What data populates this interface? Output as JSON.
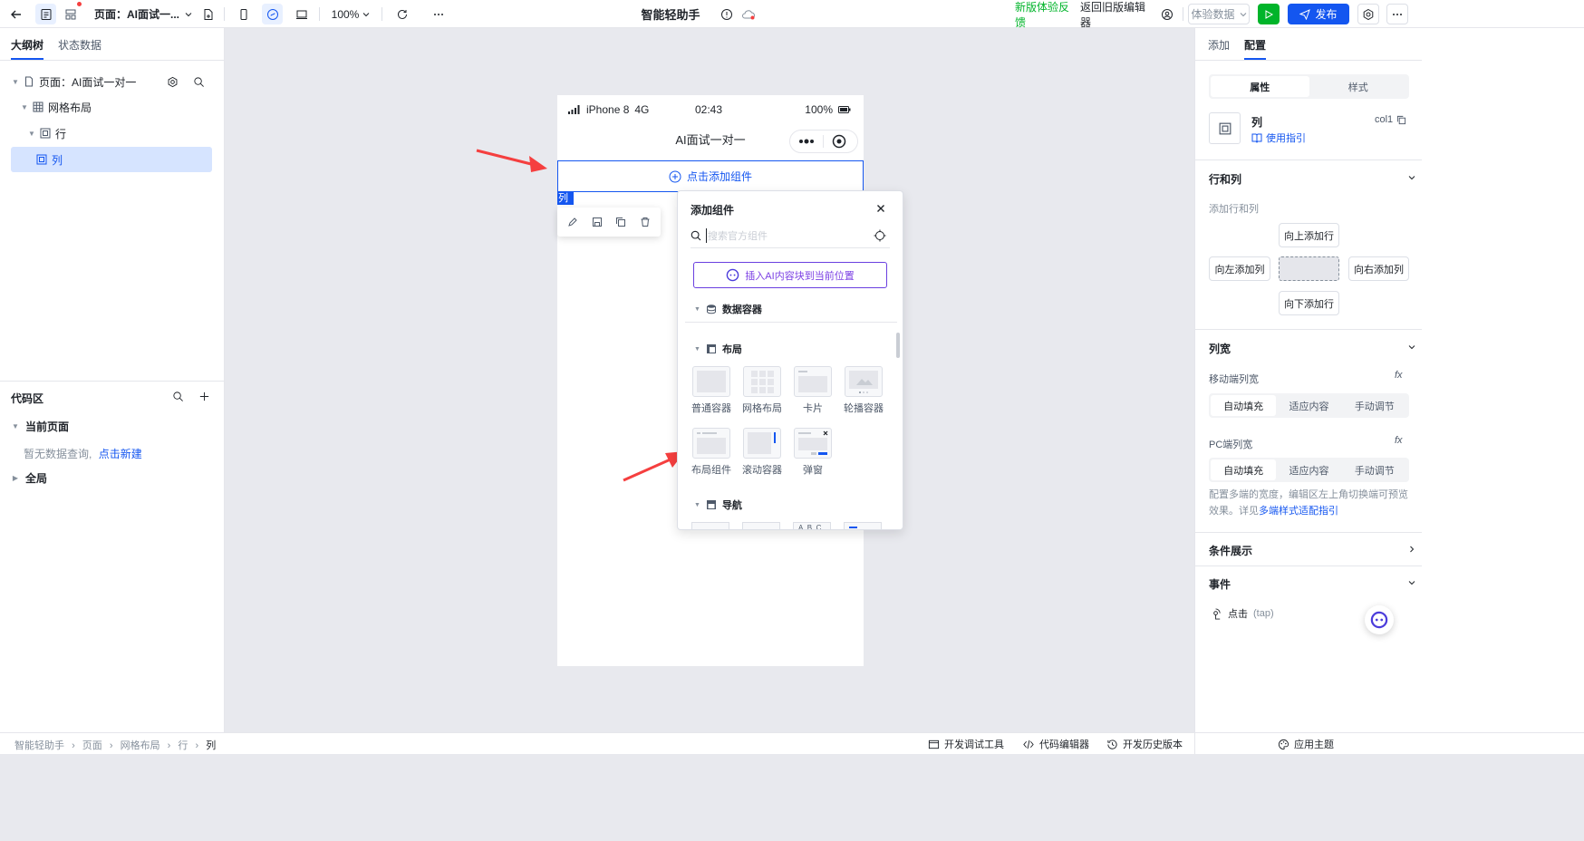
{
  "topbar": {
    "page_label": "页面：AI面试一...",
    "zoom": "100%",
    "app_title": "智能轻助手",
    "feedback_link": "新版体验反馈",
    "back_old_editor": "返回旧版编辑器",
    "experience_data": "体验数据",
    "publish_label": "发布"
  },
  "left_panel": {
    "tabs": [
      "大纲树",
      "状态数据"
    ],
    "tree": [
      {
        "label": "页面：AI面试一对一",
        "level": 0
      },
      {
        "label": "网格布局",
        "level": 1
      },
      {
        "label": "行",
        "level": 2
      },
      {
        "label": "列",
        "level": 3,
        "selected": true
      }
    ],
    "code_area": {
      "title": "代码区",
      "current_page": "当前页面",
      "empty_text": "暂无数据查询,",
      "create_link": "点击新建",
      "global": "全局"
    }
  },
  "phone": {
    "carrier": "iPhone 8",
    "network": "4G",
    "time": "02:43",
    "battery": "100%",
    "nav_title": "AI面试一对一",
    "add_component": "点击添加组件",
    "col_tag": "列"
  },
  "popup": {
    "title": "添加组件",
    "search_placeholder": "搜索官方组件",
    "ai_insert": "插入AI内容块到当前位置",
    "categories": {
      "data_container": "数据容器",
      "layout": "布局",
      "nav": "导航"
    },
    "layout_items": [
      "普通容器",
      "网格布局",
      "卡片",
      "轮播容器",
      "布局组件",
      "滚动容器",
      "弹窗"
    ]
  },
  "right_panel": {
    "tabs": [
      "添加",
      "配置"
    ],
    "seg_top": [
      "属性",
      "样式"
    ],
    "component_name": "列",
    "component_id": "col1",
    "usage_guide": "使用指引",
    "rows_cols": {
      "title": "行和列",
      "sub": "添加行和列",
      "up": "向上添加行",
      "left": "向左添加列",
      "right": "向右添加列",
      "down": "向下添加行"
    },
    "col_width": {
      "title": "列宽",
      "mobile_label": "移动端列宽",
      "pc_label": "PC端列宽",
      "options": [
        "自动填充",
        "适应内容",
        "手动调节"
      ],
      "hint": "配置多端的宽度，编辑区左上角切换端可预览效果。详见",
      "hint_link": "多端样式适配指引"
    },
    "condition": "条件展示",
    "events": {
      "title": "事件",
      "tap_label": "点击",
      "tap_code": "(tap)"
    }
  },
  "bottom": {
    "breadcrumb": [
      "智能轻助手",
      "页面",
      "网格布局",
      "行",
      "列"
    ],
    "dev_tools": "开发调试工具",
    "code_editor": "代码编辑器",
    "history": "开发历史版本",
    "theme": "应用主题"
  },
  "colors": {
    "primary": "#1456f0",
    "run_green": "#00b42a",
    "ai_purple": "#7b3fe4",
    "arrow_red": "#f53f3f"
  }
}
